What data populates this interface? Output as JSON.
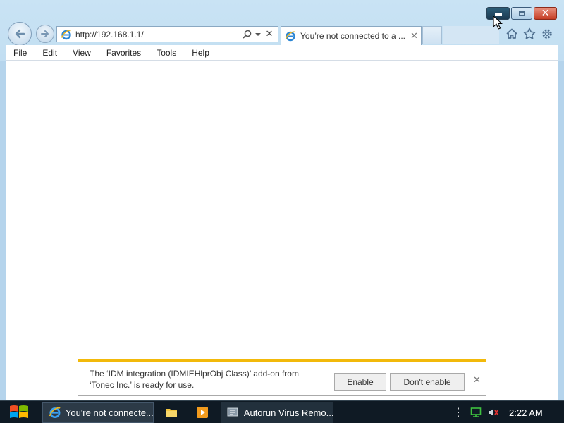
{
  "browser": {
    "address_url": "http://192.168.1.1/",
    "tab_title": "You’re not connected to a ...",
    "tab_close_glyph": "✕",
    "address_close_glyph": "✕",
    "menu": [
      "File",
      "Edit",
      "View",
      "Favorites",
      "Tools",
      "Help"
    ]
  },
  "caption_buttons": {
    "close_glyph": "✕"
  },
  "notification": {
    "line1": "The ‘IDM integration (IDMIEHlprObj Class)’ add-on from",
    "line2": "‘Tonec Inc.’ is ready for use.",
    "enable_label": "Enable",
    "dont_enable_label": "Don't enable",
    "close_glyph": "✕",
    "accent_color": "#f2b90a"
  },
  "taskbar": {
    "ie_label": "You're not connecte...",
    "autorun_label": "Autorun Virus Remo...",
    "tray_overflow": "⋮",
    "clock": "2:22 AM"
  },
  "icons": {
    "back": "back-arrow-icon",
    "forward": "forward-arrow-icon",
    "home": "home-icon",
    "favorites": "star-icon",
    "tools": "gear-icon",
    "search": "search-icon",
    "dropdown": "chevron-down-icon",
    "start": "windows-logo-icon",
    "network": "network-icon",
    "volume": "volume-muted-icon"
  }
}
